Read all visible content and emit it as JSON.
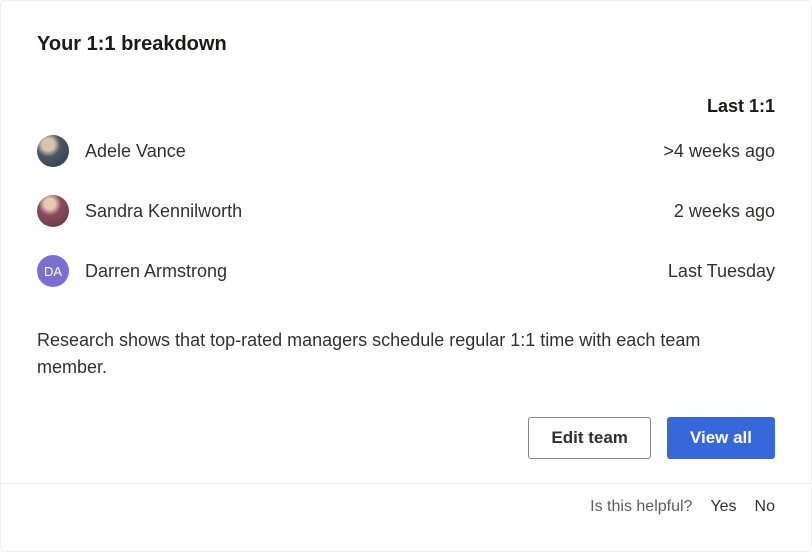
{
  "title": "Your 1:1 breakdown",
  "column_header": "Last 1:1",
  "people": [
    {
      "name": "Adele Vance",
      "last": ">4 weeks ago",
      "avatar_type": "photo-1",
      "initials": ""
    },
    {
      "name": "Sandra Kennilworth",
      "last": "2 weeks ago",
      "avatar_type": "photo-2",
      "initials": ""
    },
    {
      "name": "Darren Armstrong",
      "last": "Last Tuesday",
      "avatar_type": "initials",
      "initials": "DA"
    }
  ],
  "description": "Research shows that top-rated managers schedule regular 1:1 time with each team member.",
  "actions": {
    "edit_team": "Edit team",
    "view_all": "View all"
  },
  "feedback": {
    "prompt": "Is this helpful?",
    "yes": "Yes",
    "no": "No"
  }
}
